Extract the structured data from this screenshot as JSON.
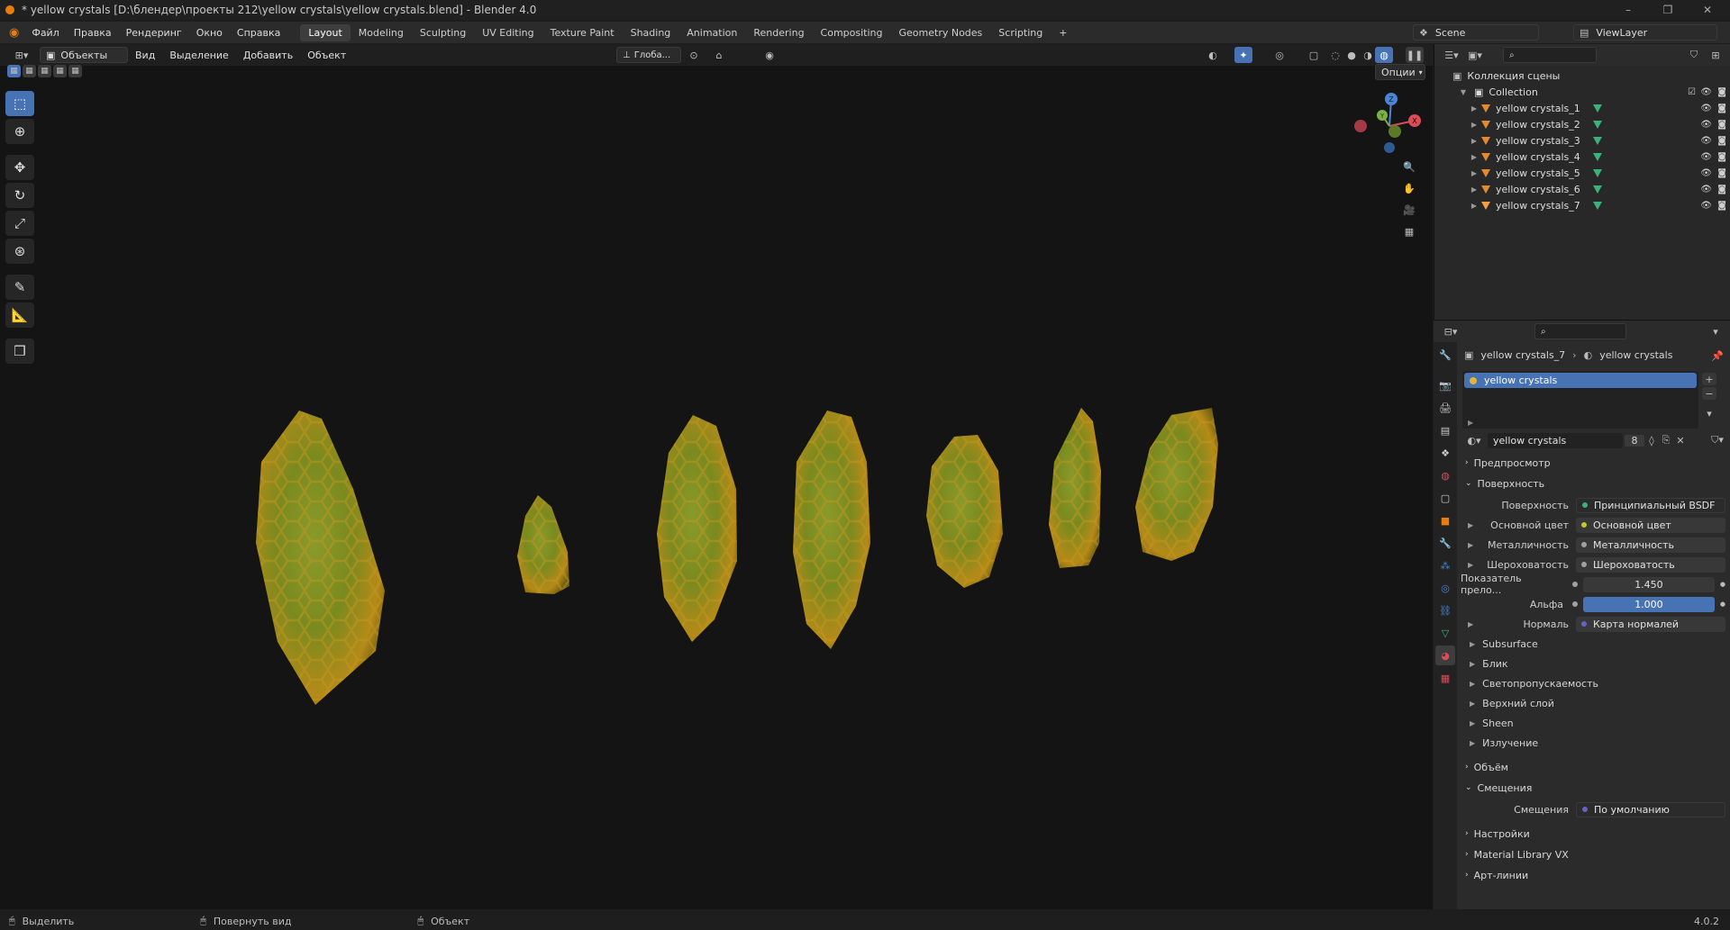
{
  "window": {
    "title": "* yellow crystals [D:\\блендер\\проекты 212\\yellow crystals\\yellow crystals.blend] - Blender 4.0",
    "minimize": "–",
    "maximize": "❐",
    "close": "✕"
  },
  "menu": {
    "items": [
      "Файл",
      "Правка",
      "Рендеринг",
      "Окно",
      "Справка"
    ]
  },
  "workspaces": [
    "Layout",
    "Modeling",
    "Sculpting",
    "UV Editing",
    "Texture Paint",
    "Shading",
    "Animation",
    "Rendering",
    "Compositing",
    "Geometry Nodes",
    "Scripting"
  ],
  "workspace_add": "+",
  "scene": {
    "name": "Scene",
    "view_layer": "ViewLayer"
  },
  "viewport_header": {
    "mode": "Объекты",
    "menus": [
      "Вид",
      "Выделение",
      "Добавить",
      "Объект"
    ],
    "transform_orientation": "Глоба...",
    "options": "Опции"
  },
  "gizmo": {
    "x": "X",
    "y": "Y",
    "z": "Z"
  },
  "outliner": {
    "search_placeholder": "",
    "scene_collection": "Коллекция сцены",
    "collection": "Collection",
    "objects": [
      "yellow crystals_1",
      "yellow crystals_2",
      "yellow crystals_3",
      "yellow crystals_4",
      "yellow crystals_5",
      "yellow crystals_6",
      "yellow crystals_7"
    ]
  },
  "properties": {
    "breadcrumb_object": "yellow crystals_7",
    "breadcrumb_material": "yellow crystals",
    "slot_name": "yellow crystals",
    "material_name": "yellow crystals",
    "user_count": "8",
    "panels": {
      "preview": "Предпросмотр",
      "surface": "Поверхность",
      "volume": "Объём",
      "displacement": "Смещения",
      "settings": "Настройки",
      "material_library": "Material Library VX",
      "lineart": "Арт-линии"
    },
    "surface_rows": [
      {
        "label": "Поверхность",
        "value": "Принципиальный BSDF",
        "dot": "#3cb27b"
      },
      {
        "label": "Основной цвет",
        "value": "Основной цвет",
        "dot": "#c7c729"
      },
      {
        "label": "Металличность",
        "value": "Металличность",
        "dot": "#a1a1a1"
      },
      {
        "label": "Шероховатость",
        "value": "Шероховатость",
        "dot": "#a1a1a1"
      },
      {
        "label": "Показатель прело...",
        "value": "1.450",
        "dot": "#a1a1a1"
      },
      {
        "label": "Альфа",
        "value": "1.000",
        "dot": "#a1a1a1"
      },
      {
        "label": "Нормаль",
        "value": "Карта нормалей",
        "dot": "#6363c7"
      }
    ],
    "subsections": [
      "Subsurface",
      "Блик",
      "Светопропускаемость",
      "Верхний слой",
      "Sheen",
      "Излучение"
    ],
    "displacement_row": {
      "label": "Смещения",
      "value": "По умолчанию",
      "dot": "#6363c7"
    }
  },
  "status": {
    "select": "Выделить",
    "rotate": "Повернуть вид",
    "object": "Объект",
    "version": "4.0.2"
  },
  "colors": {
    "accent": "#4772b3",
    "orange": "#e87d0d",
    "green": "#3cb27b"
  }
}
